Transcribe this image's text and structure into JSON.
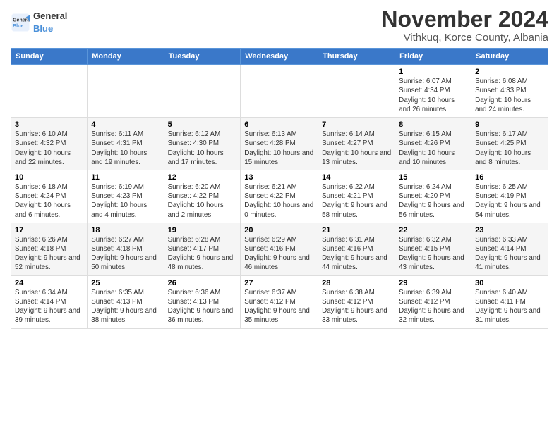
{
  "header": {
    "logo_general": "General",
    "logo_blue": "Blue",
    "title": "November 2024",
    "subtitle": "Vithkuq, Korce County, Albania"
  },
  "weekdays": [
    "Sunday",
    "Monday",
    "Tuesday",
    "Wednesday",
    "Thursday",
    "Friday",
    "Saturday"
  ],
  "weeks": [
    [
      {
        "day": "",
        "info": ""
      },
      {
        "day": "",
        "info": ""
      },
      {
        "day": "",
        "info": ""
      },
      {
        "day": "",
        "info": ""
      },
      {
        "day": "",
        "info": ""
      },
      {
        "day": "1",
        "info": "Sunrise: 6:07 AM\nSunset: 4:34 PM\nDaylight: 10 hours and 26 minutes."
      },
      {
        "day": "2",
        "info": "Sunrise: 6:08 AM\nSunset: 4:33 PM\nDaylight: 10 hours and 24 minutes."
      }
    ],
    [
      {
        "day": "3",
        "info": "Sunrise: 6:10 AM\nSunset: 4:32 PM\nDaylight: 10 hours and 22 minutes."
      },
      {
        "day": "4",
        "info": "Sunrise: 6:11 AM\nSunset: 4:31 PM\nDaylight: 10 hours and 19 minutes."
      },
      {
        "day": "5",
        "info": "Sunrise: 6:12 AM\nSunset: 4:30 PM\nDaylight: 10 hours and 17 minutes."
      },
      {
        "day": "6",
        "info": "Sunrise: 6:13 AM\nSunset: 4:28 PM\nDaylight: 10 hours and 15 minutes."
      },
      {
        "day": "7",
        "info": "Sunrise: 6:14 AM\nSunset: 4:27 PM\nDaylight: 10 hours and 13 minutes."
      },
      {
        "day": "8",
        "info": "Sunrise: 6:15 AM\nSunset: 4:26 PM\nDaylight: 10 hours and 10 minutes."
      },
      {
        "day": "9",
        "info": "Sunrise: 6:17 AM\nSunset: 4:25 PM\nDaylight: 10 hours and 8 minutes."
      }
    ],
    [
      {
        "day": "10",
        "info": "Sunrise: 6:18 AM\nSunset: 4:24 PM\nDaylight: 10 hours and 6 minutes."
      },
      {
        "day": "11",
        "info": "Sunrise: 6:19 AM\nSunset: 4:23 PM\nDaylight: 10 hours and 4 minutes."
      },
      {
        "day": "12",
        "info": "Sunrise: 6:20 AM\nSunset: 4:22 PM\nDaylight: 10 hours and 2 minutes."
      },
      {
        "day": "13",
        "info": "Sunrise: 6:21 AM\nSunset: 4:22 PM\nDaylight: 10 hours and 0 minutes."
      },
      {
        "day": "14",
        "info": "Sunrise: 6:22 AM\nSunset: 4:21 PM\nDaylight: 9 hours and 58 minutes."
      },
      {
        "day": "15",
        "info": "Sunrise: 6:24 AM\nSunset: 4:20 PM\nDaylight: 9 hours and 56 minutes."
      },
      {
        "day": "16",
        "info": "Sunrise: 6:25 AM\nSunset: 4:19 PM\nDaylight: 9 hours and 54 minutes."
      }
    ],
    [
      {
        "day": "17",
        "info": "Sunrise: 6:26 AM\nSunset: 4:18 PM\nDaylight: 9 hours and 52 minutes."
      },
      {
        "day": "18",
        "info": "Sunrise: 6:27 AM\nSunset: 4:18 PM\nDaylight: 9 hours and 50 minutes."
      },
      {
        "day": "19",
        "info": "Sunrise: 6:28 AM\nSunset: 4:17 PM\nDaylight: 9 hours and 48 minutes."
      },
      {
        "day": "20",
        "info": "Sunrise: 6:29 AM\nSunset: 4:16 PM\nDaylight: 9 hours and 46 minutes."
      },
      {
        "day": "21",
        "info": "Sunrise: 6:31 AM\nSunset: 4:16 PM\nDaylight: 9 hours and 44 minutes."
      },
      {
        "day": "22",
        "info": "Sunrise: 6:32 AM\nSunset: 4:15 PM\nDaylight: 9 hours and 43 minutes."
      },
      {
        "day": "23",
        "info": "Sunrise: 6:33 AM\nSunset: 4:14 PM\nDaylight: 9 hours and 41 minutes."
      }
    ],
    [
      {
        "day": "24",
        "info": "Sunrise: 6:34 AM\nSunset: 4:14 PM\nDaylight: 9 hours and 39 minutes."
      },
      {
        "day": "25",
        "info": "Sunrise: 6:35 AM\nSunset: 4:13 PM\nDaylight: 9 hours and 38 minutes."
      },
      {
        "day": "26",
        "info": "Sunrise: 6:36 AM\nSunset: 4:13 PM\nDaylight: 9 hours and 36 minutes."
      },
      {
        "day": "27",
        "info": "Sunrise: 6:37 AM\nSunset: 4:12 PM\nDaylight: 9 hours and 35 minutes."
      },
      {
        "day": "28",
        "info": "Sunrise: 6:38 AM\nSunset: 4:12 PM\nDaylight: 9 hours and 33 minutes."
      },
      {
        "day": "29",
        "info": "Sunrise: 6:39 AM\nSunset: 4:12 PM\nDaylight: 9 hours and 32 minutes."
      },
      {
        "day": "30",
        "info": "Sunrise: 6:40 AM\nSunset: 4:11 PM\nDaylight: 9 hours and 31 minutes."
      }
    ]
  ]
}
